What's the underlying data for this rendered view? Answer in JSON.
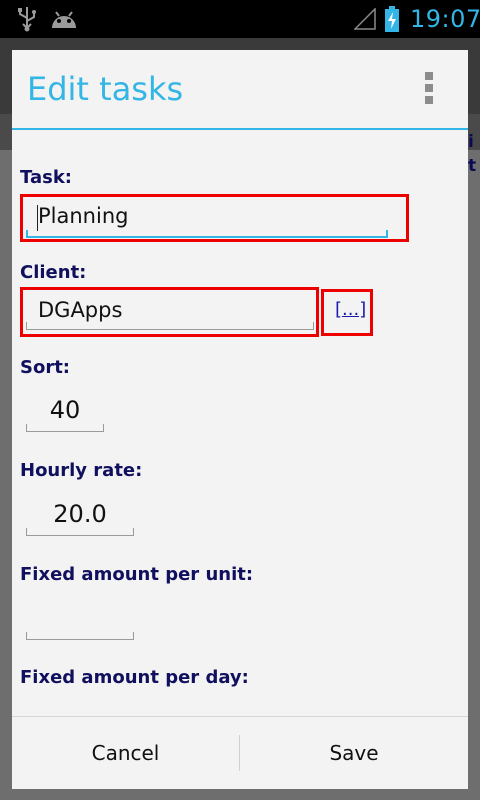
{
  "status_bar": {
    "time": "19:07",
    "icons": [
      "usb-icon",
      "android-debug-icon",
      "signal-icon",
      "battery-charging-icon"
    ]
  },
  "background": {
    "peek_chars": [
      "i",
      "t"
    ]
  },
  "dialog": {
    "title": "Edit tasks",
    "menu_icon": "overflow-menu-icon",
    "accent_color": "#33b5e5",
    "label_color": "#10105e",
    "highlight_color": "#ee0000"
  },
  "form": {
    "task": {
      "label": "Task:",
      "value": "Planning"
    },
    "client": {
      "label": "Client:",
      "value": "DGApps",
      "browse_label": "[...]"
    },
    "sort": {
      "label": "Sort:",
      "value": "40"
    },
    "hourly_rate": {
      "label": "Hourly rate:",
      "value": "20.0"
    },
    "fixed_per_unit": {
      "label": "Fixed amount per unit:",
      "value": ""
    },
    "fixed_per_day": {
      "label": "Fixed amount per day:"
    }
  },
  "buttons": {
    "cancel": "Cancel",
    "save": "Save"
  }
}
